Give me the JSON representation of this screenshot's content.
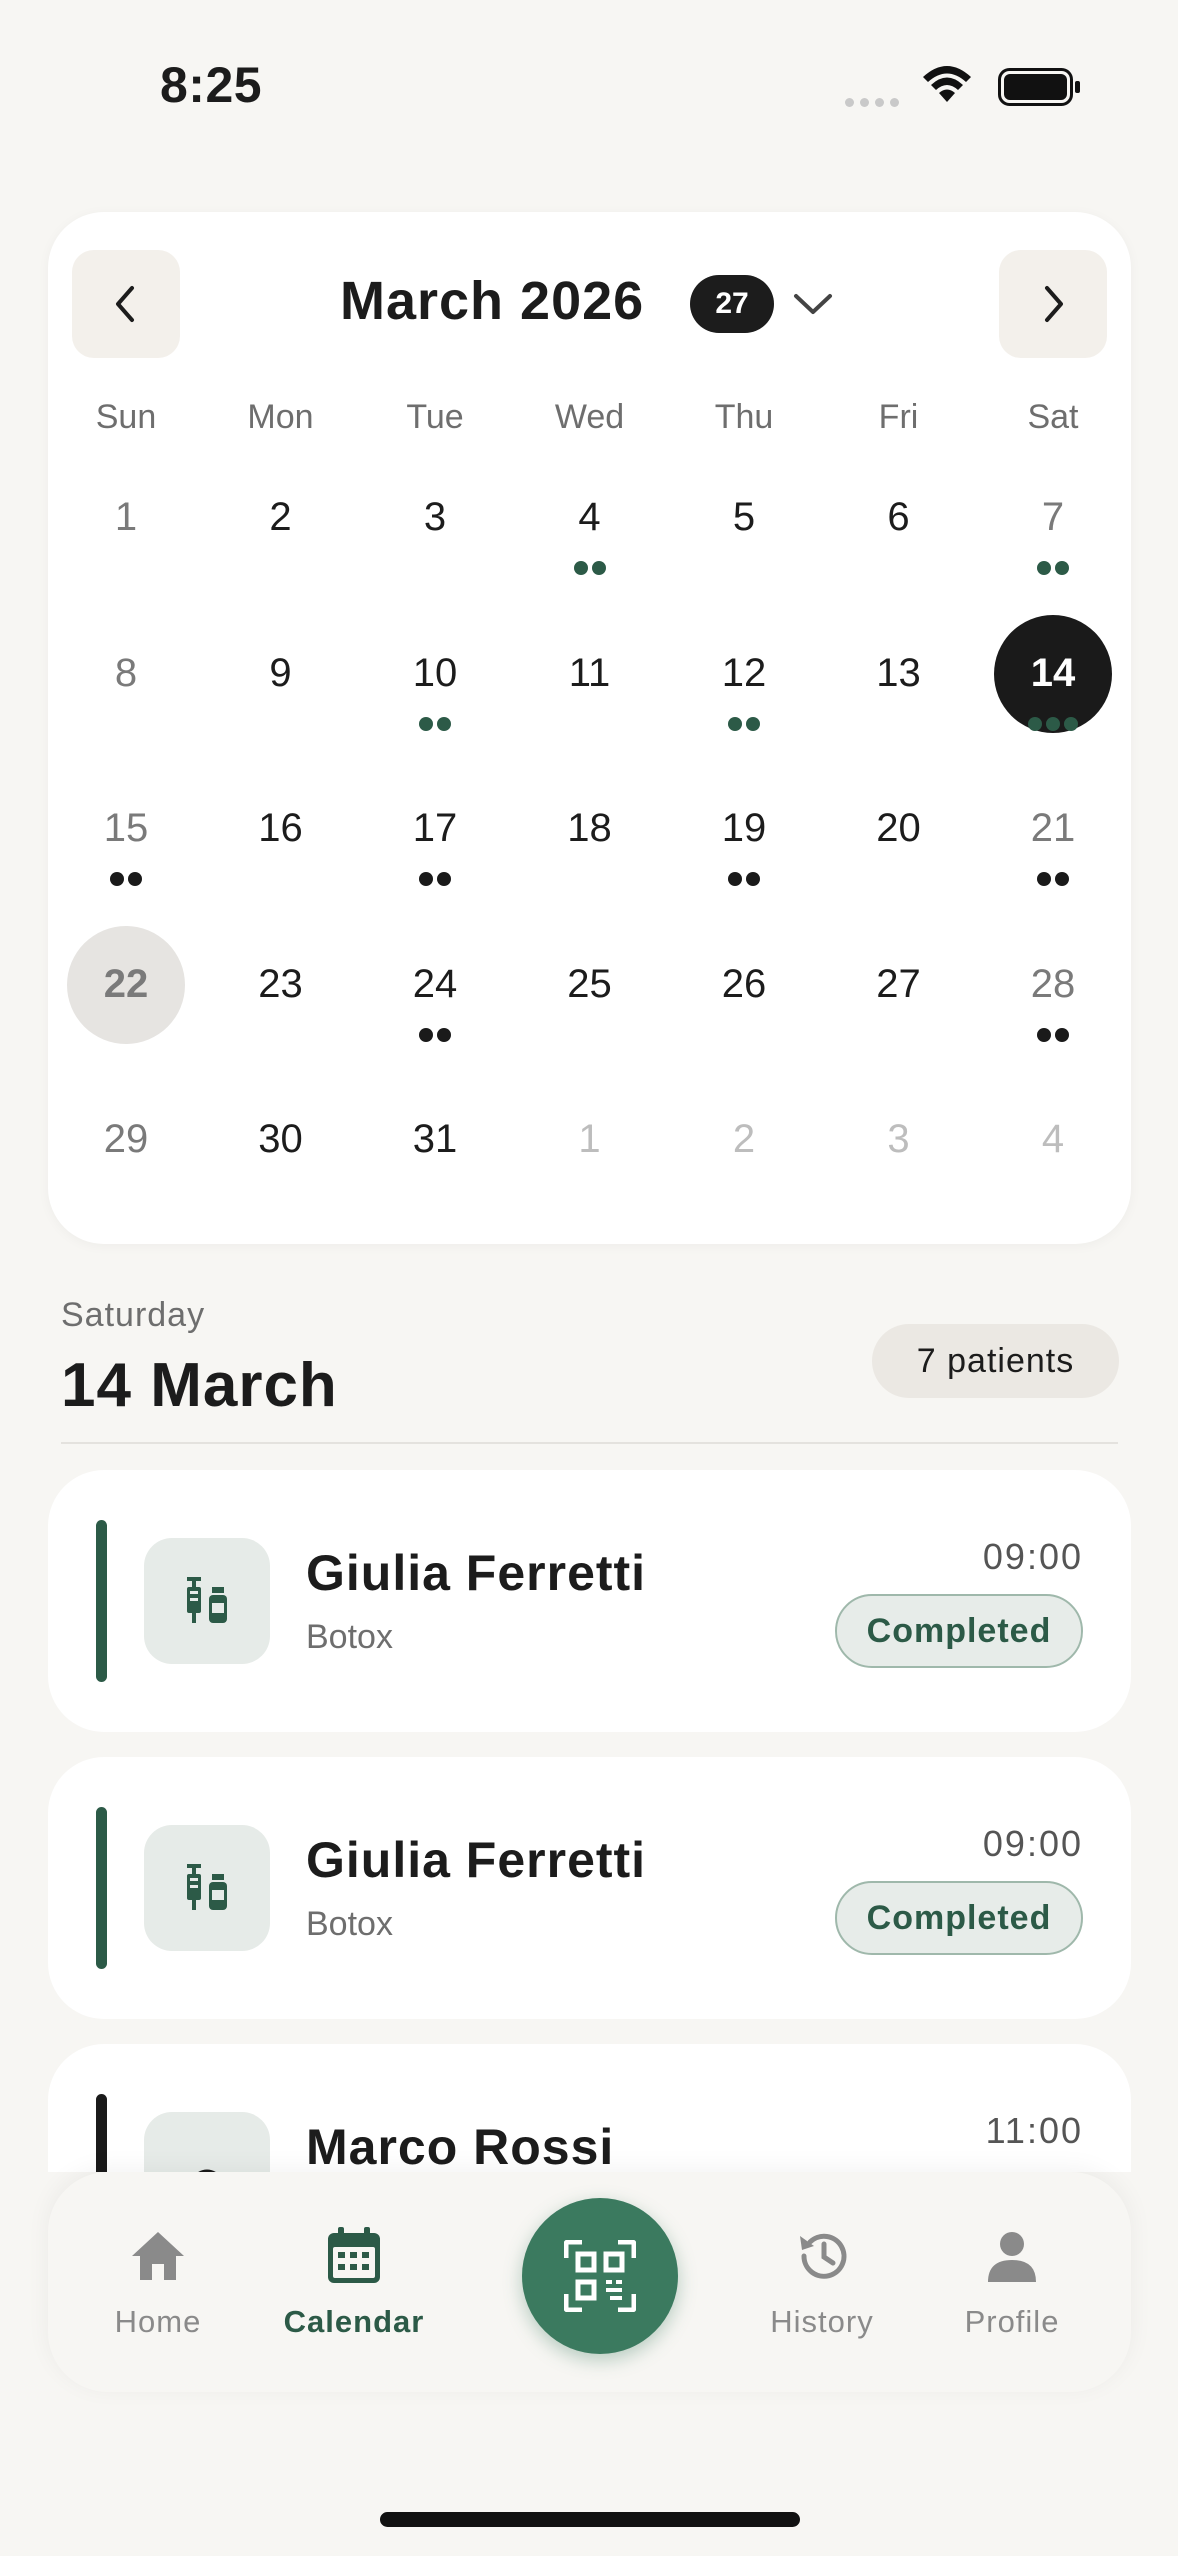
{
  "status_bar": {
    "time": "8:25"
  },
  "calendar": {
    "month_title": "March 2026",
    "appointment_count": "27",
    "weekdays": [
      "Sun",
      "Mon",
      "Tue",
      "Wed",
      "Thu",
      "Fri",
      "Sat"
    ],
    "weeks": [
      [
        {
          "n": "1"
        },
        {
          "n": "2"
        },
        {
          "n": "3"
        },
        {
          "n": "4",
          "dots": 2,
          "c": "green"
        },
        {
          "n": "5"
        },
        {
          "n": "6"
        },
        {
          "n": "7",
          "dots": 2,
          "c": "green"
        }
      ],
      [
        {
          "n": "8"
        },
        {
          "n": "9"
        },
        {
          "n": "10",
          "dots": 2,
          "c": "green"
        },
        {
          "n": "11"
        },
        {
          "n": "12",
          "dots": 2,
          "c": "green"
        },
        {
          "n": "13"
        },
        {
          "n": "14",
          "dots": 3,
          "c": "green",
          "selected": true
        }
      ],
      [
        {
          "n": "15",
          "dots": 2,
          "c": "black"
        },
        {
          "n": "16"
        },
        {
          "n": "17",
          "dots": 2,
          "c": "black"
        },
        {
          "n": "18"
        },
        {
          "n": "19",
          "dots": 2,
          "c": "black"
        },
        {
          "n": "20"
        },
        {
          "n": "21",
          "dots": 2,
          "c": "black"
        }
      ],
      [
        {
          "n": "22",
          "today": true
        },
        {
          "n": "23"
        },
        {
          "n": "24",
          "dots": 2,
          "c": "black"
        },
        {
          "n": "25"
        },
        {
          "n": "26"
        },
        {
          "n": "27"
        },
        {
          "n": "28",
          "dots": 2,
          "c": "black"
        }
      ],
      [
        {
          "n": "29"
        },
        {
          "n": "30"
        },
        {
          "n": "31"
        },
        {
          "n": "1",
          "outside": true
        },
        {
          "n": "2",
          "outside": true
        },
        {
          "n": "3",
          "outside": true
        },
        {
          "n": "4",
          "outside": true
        }
      ]
    ]
  },
  "day_header": {
    "weekday": "Saturday",
    "date": "14 March",
    "patients": "7 patients"
  },
  "appointments": [
    {
      "name": "Giulia Ferretti",
      "treatment": "Botox",
      "time": "09:00",
      "status": "Completed",
      "bar_color": "#2c5a47",
      "icon": "syringe-vial-icon"
    },
    {
      "name": "Giulia Ferretti",
      "treatment": "Botox",
      "time": "09:00",
      "status": "Completed",
      "bar_color": "#2c5a47",
      "icon": "syringe-vial-icon"
    },
    {
      "name": "Marco Rossi",
      "treatment": "",
      "time": "11:00",
      "status": "",
      "bar_color": "#1a1a1a",
      "icon": "treatment-icon"
    }
  ],
  "tabbar": {
    "home": "Home",
    "calendar": "Calendar",
    "history": "History",
    "profile": "Profile"
  },
  "colors": {
    "accent": "#3b7a5f",
    "dot_green": "#2c5a47",
    "dot_black": "#1a1a1a"
  }
}
